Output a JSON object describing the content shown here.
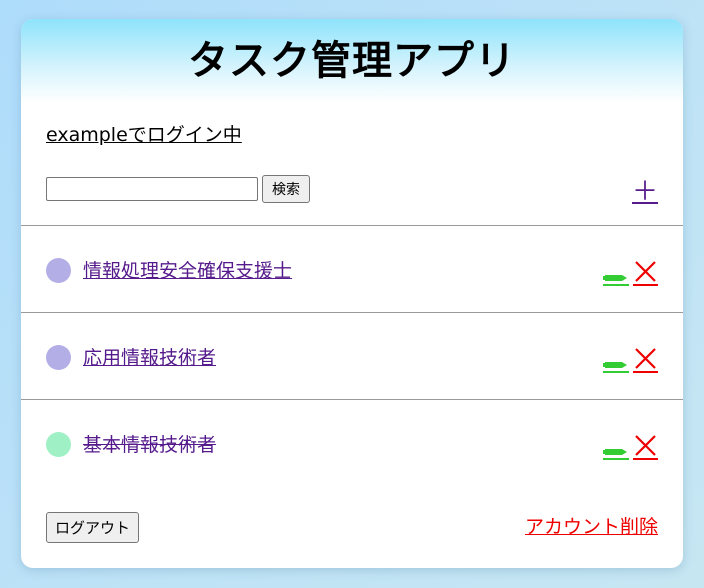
{
  "app": {
    "title": "タスク管理アプリ"
  },
  "session": {
    "login_text": "exampleでログイン中"
  },
  "search": {
    "value": "",
    "placeholder": "",
    "button_label": "検索"
  },
  "toolbar": {
    "add_label": "＋"
  },
  "tasks": [
    {
      "title": "情報処理安全確保支援士",
      "dot_color": "#b3aee6",
      "done": false
    },
    {
      "title": "応用情報技術者",
      "dot_color": "#b3aee6",
      "done": false
    },
    {
      "title": "基本情報技術者",
      "dot_color": "#9ff0c4",
      "done": true
    }
  ],
  "footer": {
    "logout_label": "ログアウト",
    "delete_account_label": "アカウント削除"
  },
  "colors": {
    "header_gradient_top": "#8ee3fb",
    "link_visited": "#551a8b",
    "edit_green": "#33cc33",
    "delete_red": "#ee0000"
  },
  "icons": {
    "add": "plus-icon",
    "edit": "pencil-icon",
    "delete": "close-icon"
  }
}
